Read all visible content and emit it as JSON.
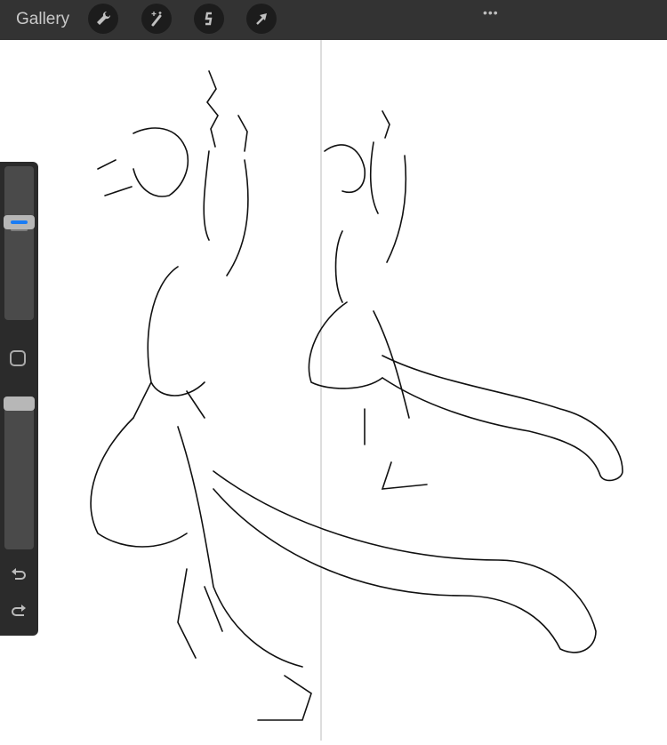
{
  "topbar": {
    "gallery_label": "Gallery",
    "tools": [
      "wrench-icon",
      "magic-wand-icon",
      "selection-icon",
      "transform-arrow-icon"
    ],
    "more_label": "•••"
  },
  "sidebar": {
    "brush_size": 0.65,
    "brush_opacity": 1.0,
    "accent_color": "#1a7cf5"
  }
}
